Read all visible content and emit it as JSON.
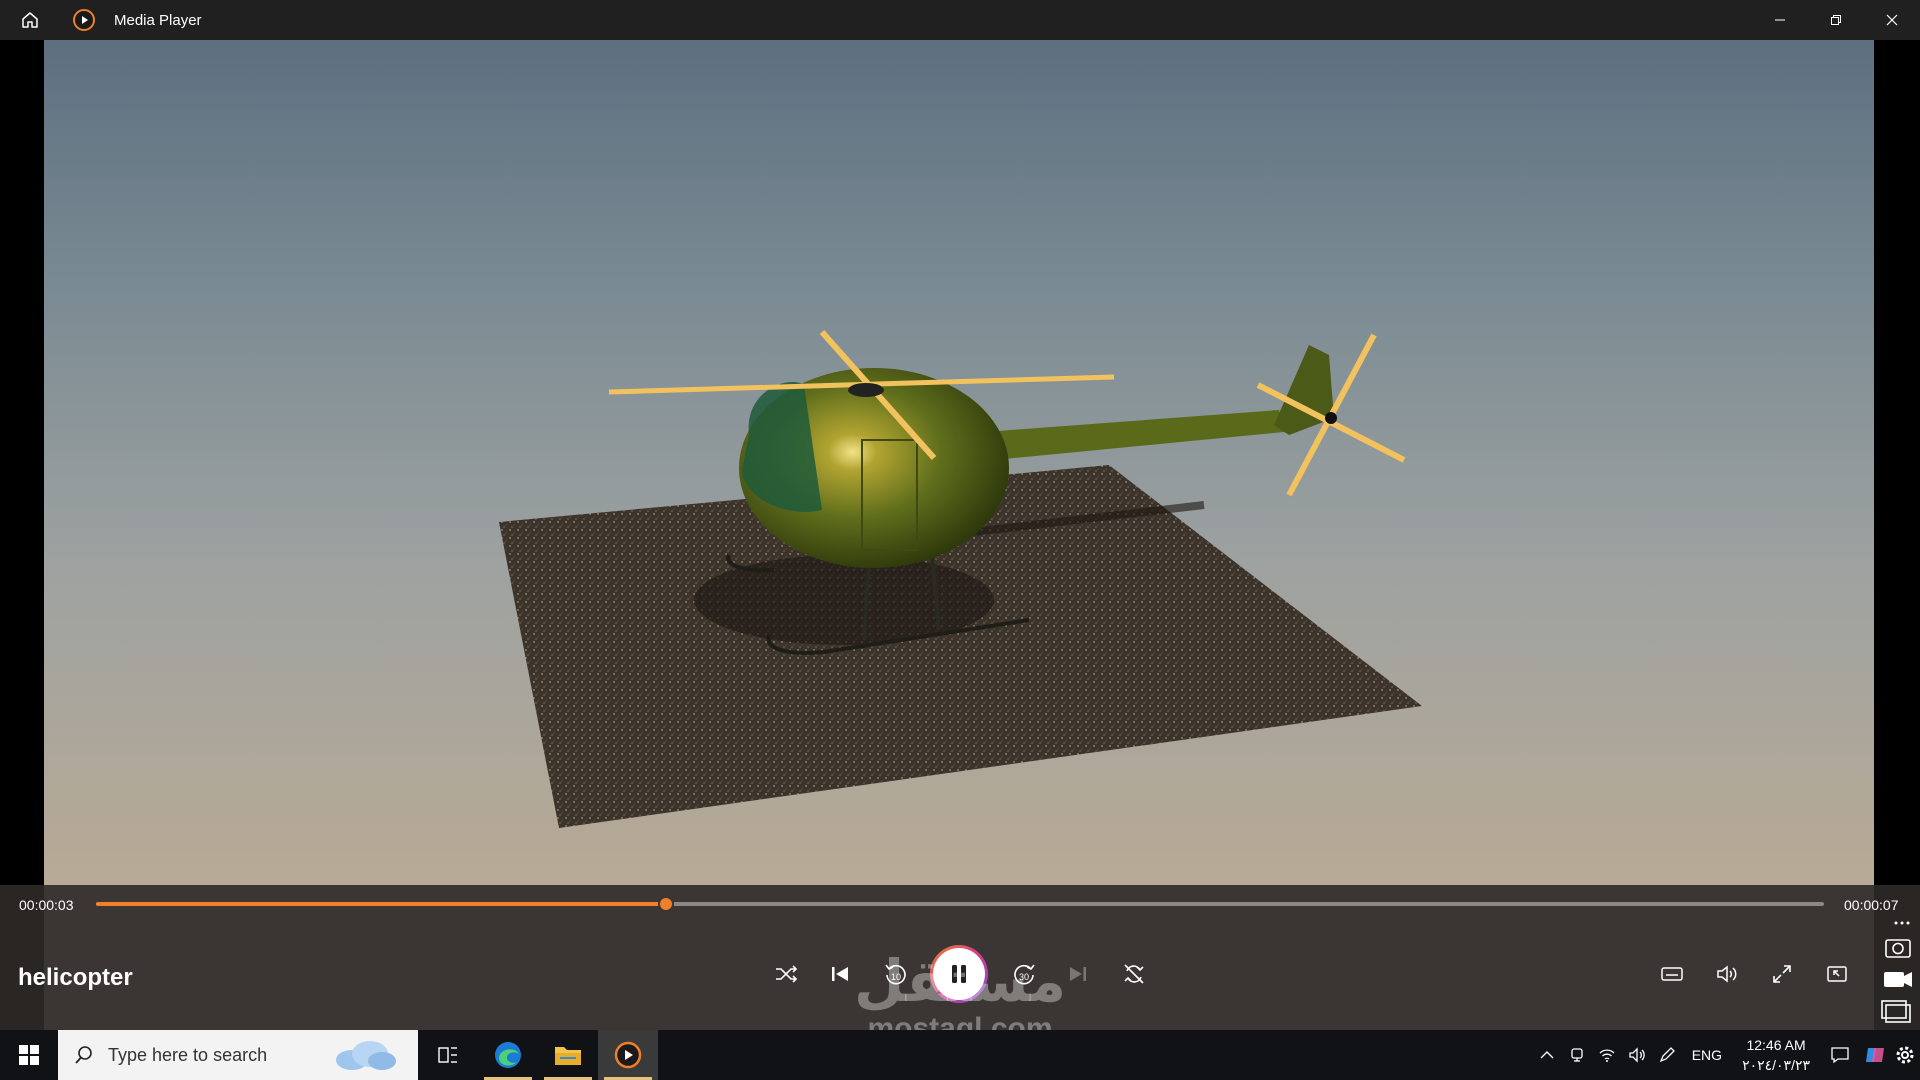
{
  "window": {
    "title": "Media Player"
  },
  "player": {
    "current_time": "00:00:03",
    "duration": "00:00:07",
    "progress_fraction": 0.33,
    "media_title": "helicopter",
    "accent_color": "#f07f2a",
    "buttons": {
      "shuffle": "shuffle-icon",
      "previous": "previous-icon",
      "skip_back": "10",
      "play_pause": "pause-icon",
      "skip_forward": "30",
      "next": "next-icon",
      "repeat": "repeat-off-icon",
      "captions": "captions-icon",
      "volume": "volume-icon",
      "fullscreen": "fullscreen-icon",
      "mini_player": "mini-player-icon"
    }
  },
  "watermark": {
    "arabic": "مستقل",
    "latin": "mostaql.com"
  },
  "taskbar": {
    "search_placeholder": "Type here to search",
    "language": "ENG",
    "time": "12:46 AM",
    "date": "٢٠٢٤/٠٣/٢٣"
  }
}
